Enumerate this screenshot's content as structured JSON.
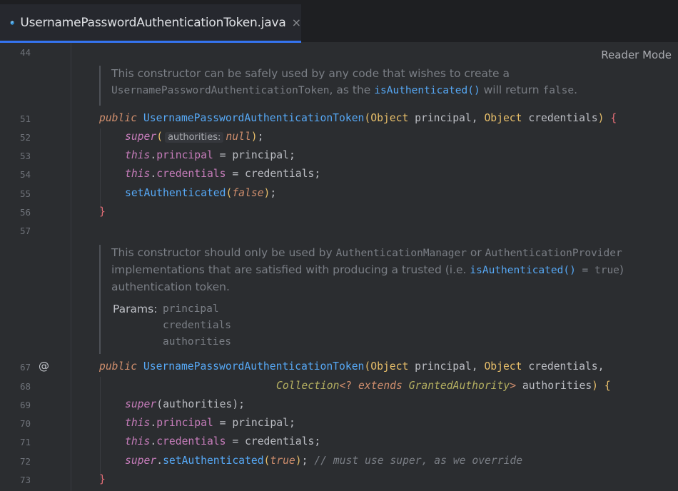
{
  "tab": {
    "title": "UsernamePasswordAuthenticationToken.java",
    "close_glyph": "×",
    "icon": "java-class-icon",
    "accent": "#3574f0"
  },
  "reader_mode": "Reader Mode",
  "line_numbers": [
    "44",
    "51",
    "52",
    "53",
    "54",
    "55",
    "56",
    "57",
    "67",
    "68",
    "69",
    "70",
    "71",
    "72",
    "73"
  ],
  "gutter_marker": "@",
  "doc1": {
    "t1": "This constructor can be safely used by any code that wishes to create a",
    "c1": "UsernamePasswordAuthenticationToken",
    "t2": ", as the ",
    "link1": "isAuthenticated()",
    "t3": " will return ",
    "c2": "false",
    "t4": "."
  },
  "doc2": {
    "t1": "This constructor should only be used by ",
    "c1": "AuthenticationManager",
    "t2": " or ",
    "c2": "AuthenticationProvider",
    "t3": "implementations that are satisfied with producing a trusted (i.e. ",
    "link1": "isAuthenticated()",
    "c3": " = true",
    "t4": ")",
    "t5": "authentication token.",
    "params_label": "Params:",
    "params": [
      "principal",
      "credentials",
      "authorities"
    ]
  },
  "code": {
    "public": "public",
    "class_name": "UsernamePasswordAuthenticationToken",
    "object": "Object",
    "principal": "principal",
    "credentials": "credentials",
    "super": "super",
    "this": "this",
    "hint_authorities": "authorities:",
    "null": "null",
    "false": "false",
    "true": "true",
    "set_auth": "setAuthenticated",
    "collection": "Collection",
    "extends": "extends",
    "granted": "GrantedAuthority",
    "authorities": "authorities",
    "comment": "// must use super, as we override"
  }
}
